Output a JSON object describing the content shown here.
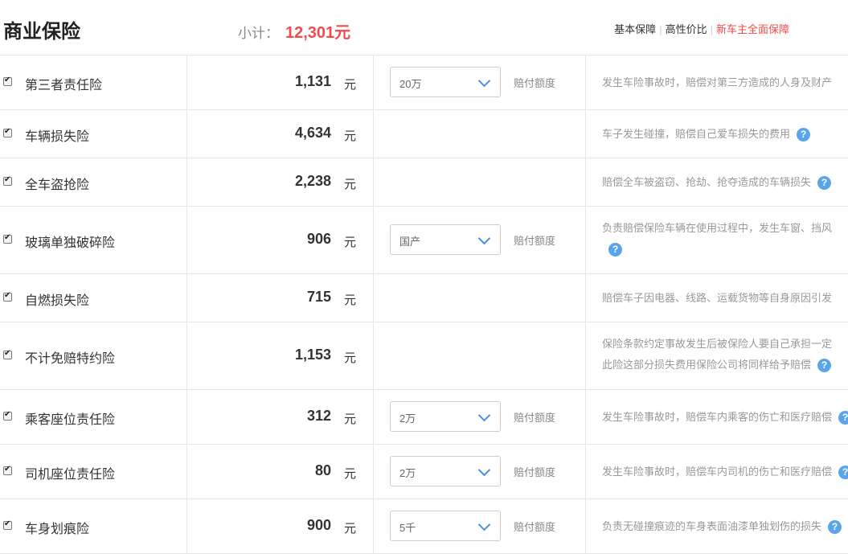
{
  "header": {
    "title": "商业保险",
    "subtotal_label": "小计：",
    "subtotal_amount": "12,301元",
    "plans": [
      "基本保障",
      "高性价比",
      "新车主全面保障"
    ],
    "highlight_color": "#f04b4b"
  },
  "rows": [
    {
      "name": "第三者责任险",
      "price": "1,131",
      "unit": "元",
      "select": "20万",
      "label": "赔付额度",
      "desc": [
        "发生车险事故时，赔偿对第三方造成的人身及财产"
      ]
    },
    {
      "name": "车辆损失险",
      "price": "4,634",
      "unit": "元",
      "desc": [
        "车子发生碰撞，赔偿自己爱车损失的费用"
      ]
    },
    {
      "name": "全车盗抢险",
      "price": "2,238",
      "unit": "元",
      "desc": [
        "赔偿全车被盗窃、抢劫、抢夺造成的车辆损失"
      ]
    },
    {
      "name": "玻璃单独破碎险",
      "price": "906",
      "unit": "元",
      "select": "国产",
      "label": "赔付额度",
      "desc": [
        "负责赔偿保险车辆在使用过程中，发生车窗、挡风",
        ""
      ]
    },
    {
      "name": "自燃损失险",
      "price": "715",
      "unit": "元",
      "desc": [
        "赔偿车子因电器、线路、运载货物等自身原因引发"
      ]
    },
    {
      "name": "不计免赔特约险",
      "price": "1,153",
      "unit": "元",
      "desc": [
        "保险条款约定事故发生后被保险人要自己承担一定",
        "此险这部分损失费用保险公司将同样给予赔偿"
      ]
    },
    {
      "name": "乘客座位责任险",
      "price": "312",
      "unit": "元",
      "select": "2万",
      "label": "赔付额度",
      "desc": [
        "发生车险事故时，赔偿车内乘客的伤亡和医疗赔偿"
      ]
    },
    {
      "name": "司机座位责任险",
      "price": "80",
      "unit": "元",
      "select": "2万",
      "label": "赔付额度",
      "desc": [
        "发生车险事故时，赔偿车内司机的伤亡和医疗赔偿"
      ]
    },
    {
      "name": "车身划痕险",
      "price": "900",
      "unit": "元",
      "select": "5千",
      "label": "赔付额度",
      "desc": [
        "负责无碰撞痕迹的车身表面油漆单独划伤的损失"
      ]
    }
  ],
  "help_glyph": "?"
}
